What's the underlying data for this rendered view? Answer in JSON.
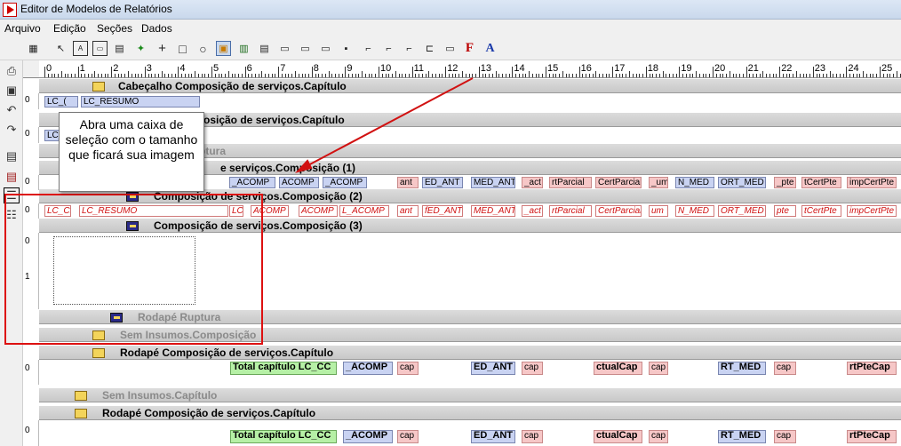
{
  "window": {
    "title": "Editor de Modelos de Relatórios"
  },
  "menu": [
    "Arquivo",
    "Edição",
    "Seções",
    "Dados"
  ],
  "toolbar": {
    "icons": [
      "grid-icon",
      "pointer-icon",
      "label-icon",
      "field-icon",
      "form-icon",
      "link-icon",
      "cross-icon",
      "rectangle-icon",
      "circle-icon",
      "image-icon",
      "chart-icon",
      "memo-icon",
      "box-icon",
      "box2-icon",
      "box3-icon",
      "dots-icon",
      "frame1-icon",
      "frame2-icon",
      "frame3-icon",
      "frame4-icon",
      "frame5-icon",
      "font-color-icon",
      "font-icon"
    ]
  },
  "ruler": {
    "numbers": [
      "0",
      "1",
      "2",
      "3",
      "4",
      "5",
      "6",
      "7",
      "8",
      "9",
      "10",
      "11",
      "12",
      "13",
      "14",
      "15",
      "16",
      "17",
      "18",
      "19",
      "20",
      "21",
      "22",
      "23",
      "24",
      "25"
    ]
  },
  "bands": {
    "b1": "Cabeçalho Composição de serviços.Capítulo",
    "b2": "osição de serviços.Capítulo",
    "b3": "ptura",
    "b4": "e serviços.Composição (1)",
    "b5": "Composição de serviços.Composição (2)",
    "b6": "Composição de serviços.Composição (3)",
    "b7": "Rodapé Ruptura",
    "b8": "Sem Insumos.Composição",
    "b9": "Rodapé Composição de serviços.Capítulo",
    "b10": "Sem Insumos.Capítulo",
    "b11": "Rodapé Composição de serviços.Capítulo"
  },
  "vruler": {
    "zero": "0",
    "one": "1"
  },
  "fields": {
    "r1": [
      "LC_(",
      "LC_RESUMO"
    ],
    "r2": [
      "LC_"
    ],
    "r4": [
      "_ACOMP",
      "ACOMP",
      "_ACOMP",
      "ant",
      "ED_ANT",
      "MED_ANT",
      "_act",
      "rtParcial",
      "CertParcial",
      "_um",
      "N_MED",
      "ORT_MED",
      "_pte",
      "tCertPte",
      "impCertPte"
    ],
    "r5": [
      "LC_Ci",
      "LC_RESUMO",
      "LC",
      "ACOMP",
      "ACOMP",
      "L_ACOMP",
      "ant",
      "fED_ANT",
      "MED_ANT",
      "_act",
      "rtParcial",
      "CertParcial",
      "um",
      "N_MED",
      "ORT_MED",
      "pte",
      "tCertPte",
      "impCertPte"
    ],
    "footer1": [
      "Total capítulo LC_CC",
      "_ACOMP",
      "cap",
      "ED_ANT",
      "cap",
      "ctualCap",
      "cap",
      "RT_MED",
      "cap",
      "rtPteCap"
    ],
    "footer2": [
      "Total capítulo LC_CC",
      "_ACOMP",
      "cap",
      "ED_ANT",
      "cap",
      "ctualCap",
      "cap",
      "RT_MED",
      "cap",
      "rtPteCap"
    ]
  },
  "tooltip": {
    "text": "Abra uma caixa de seleção com o tamanho que ficará sua imagem"
  },
  "colors": {
    "annotation": "#d11111",
    "band": "#c8c8c8",
    "field_blue": "#c9d3f2",
    "field_pink": "#f6c7c7",
    "field_green": "#b6f0a6"
  }
}
